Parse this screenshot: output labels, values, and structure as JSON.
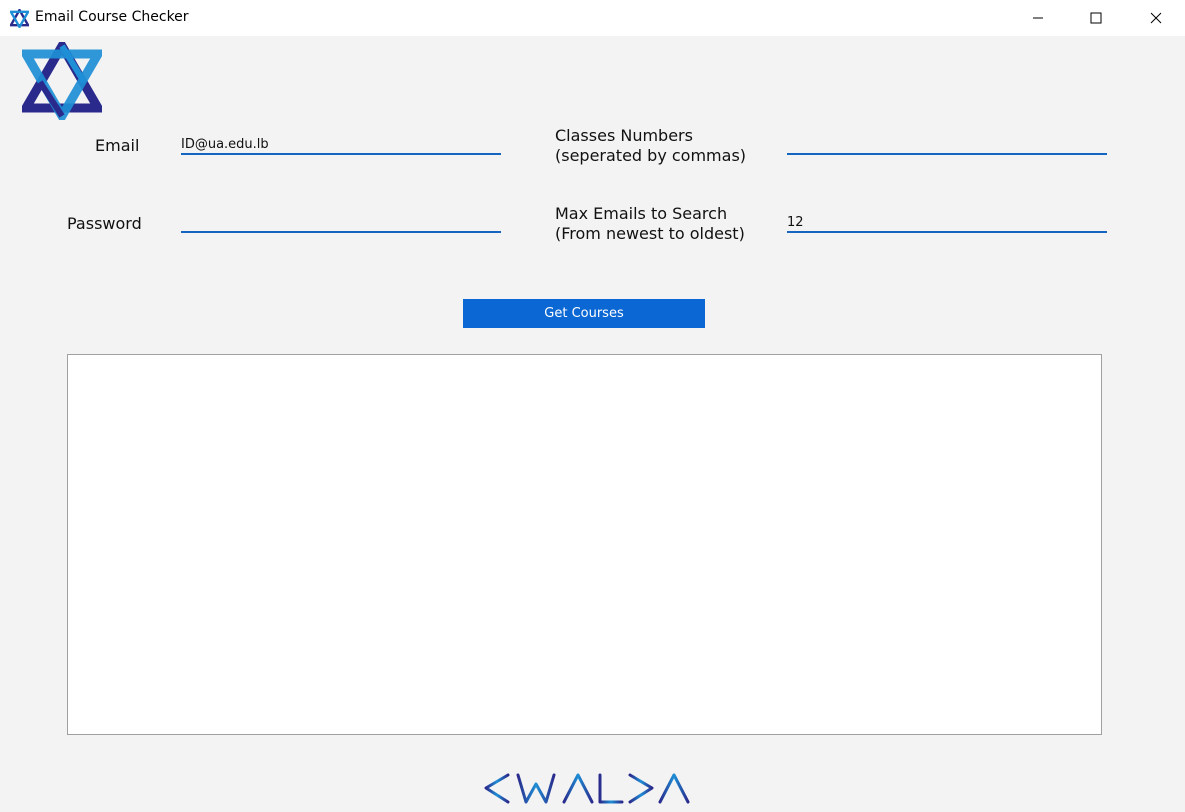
{
  "window": {
    "title": "Email Course Checker",
    "controls": [
      "minimize-icon",
      "maximize-icon",
      "close-icon"
    ]
  },
  "logo": {
    "icon": "star-logo-icon",
    "colors": [
      "#2a2a8c",
      "#1e8fd6"
    ]
  },
  "form": {
    "email_label": "Email",
    "email_value": "ID@ua.edu.lb",
    "password_label": "Password",
    "password_value": "",
    "classes_label_line1": "Classes Numbers",
    "classes_label_line2": "(seperated by commas)",
    "classes_value": "",
    "max_label_line1": "Max Emails to Search",
    "max_label_line2": "(From newest to oldest)",
    "max_value": "12"
  },
  "actions": {
    "get_courses_label": "Get Courses"
  },
  "output": {
    "text": ""
  },
  "brand": {
    "text": "KWALKA"
  },
  "colors": {
    "accent": "#0b67d3",
    "underline": "#1565c0",
    "background": "#f3f3f3"
  }
}
